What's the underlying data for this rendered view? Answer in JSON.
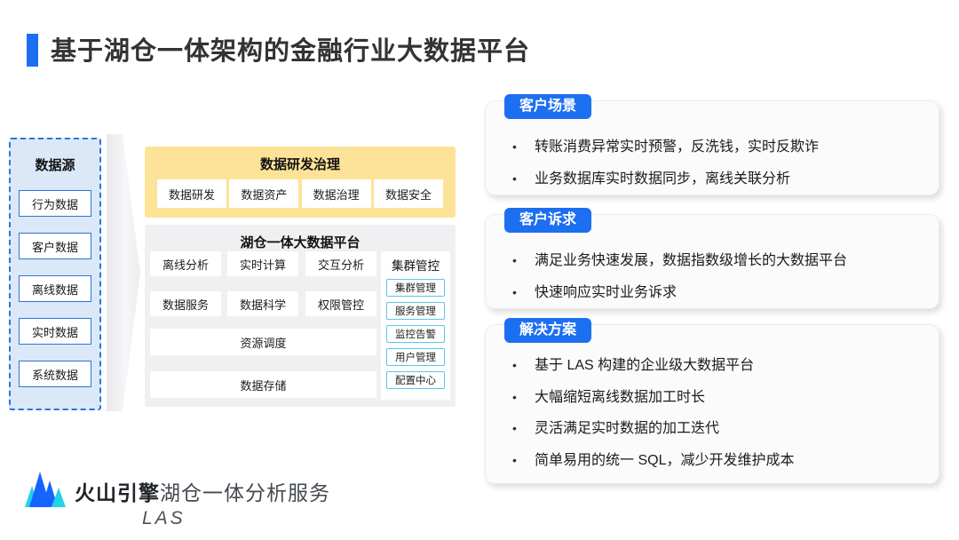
{
  "title": {
    "text": "基于湖仓一体架构的金融行业大数据平台"
  },
  "data_sources": {
    "title": "数据源",
    "items": [
      "行为数据",
      "客户数据",
      "离线数据",
      "实时数据",
      "系统数据"
    ]
  },
  "dev_governance": {
    "title": "数据研发治理",
    "items": [
      "数据研发",
      "数据资产",
      "数据治理",
      "数据安全"
    ]
  },
  "platform": {
    "title": "湖仓一体大数据平台",
    "modules": [
      "离线分析",
      "实时计算",
      "交互分析",
      "数据服务",
      "数据科学",
      "权限管控"
    ],
    "wide_modules": [
      "资源调度",
      "数据存储"
    ],
    "cluster_control": {
      "title": "集群管控",
      "items": [
        "集群管理",
        "服务管理",
        "监控告警",
        "用户管理",
        "配置中心"
      ]
    }
  },
  "cards": [
    {
      "badge": "客户场景",
      "bullets": [
        "转账消费异常实时预警，反洗钱，实时反欺诈",
        "业务数据库实时数据同步，离线关联分析"
      ]
    },
    {
      "badge": "客户诉求",
      "bullets": [
        "满足业务快速发展，数据指数级增长的大数据平台",
        "快速响应实时业务诉求"
      ]
    },
    {
      "badge": "解决方案",
      "bullets": [
        "基于 LAS 构建的企业级大数据平台",
        "大幅缩短离线数据加工时长",
        "灵活满足实时数据的加工迭代",
        "简单易用的统一 SQL，减少开发维护成本"
      ]
    }
  ],
  "footer": {
    "brand": "火山引擎",
    "product": "湖仓一体分析服务",
    "product_abbr": "LAS"
  },
  "colors": {
    "accent_blue": "#1d6ff2",
    "panel_border_blue": "#2e74d9",
    "panel_fill_blue": "#dbe8f8",
    "governance_yellow": "#fde398",
    "platform_gray": "#f0f0f2",
    "cluster_item_border_cyan": "#5bc6ee",
    "logo_blue": "#1664ff",
    "logo_cyan": "#22d3e8"
  }
}
